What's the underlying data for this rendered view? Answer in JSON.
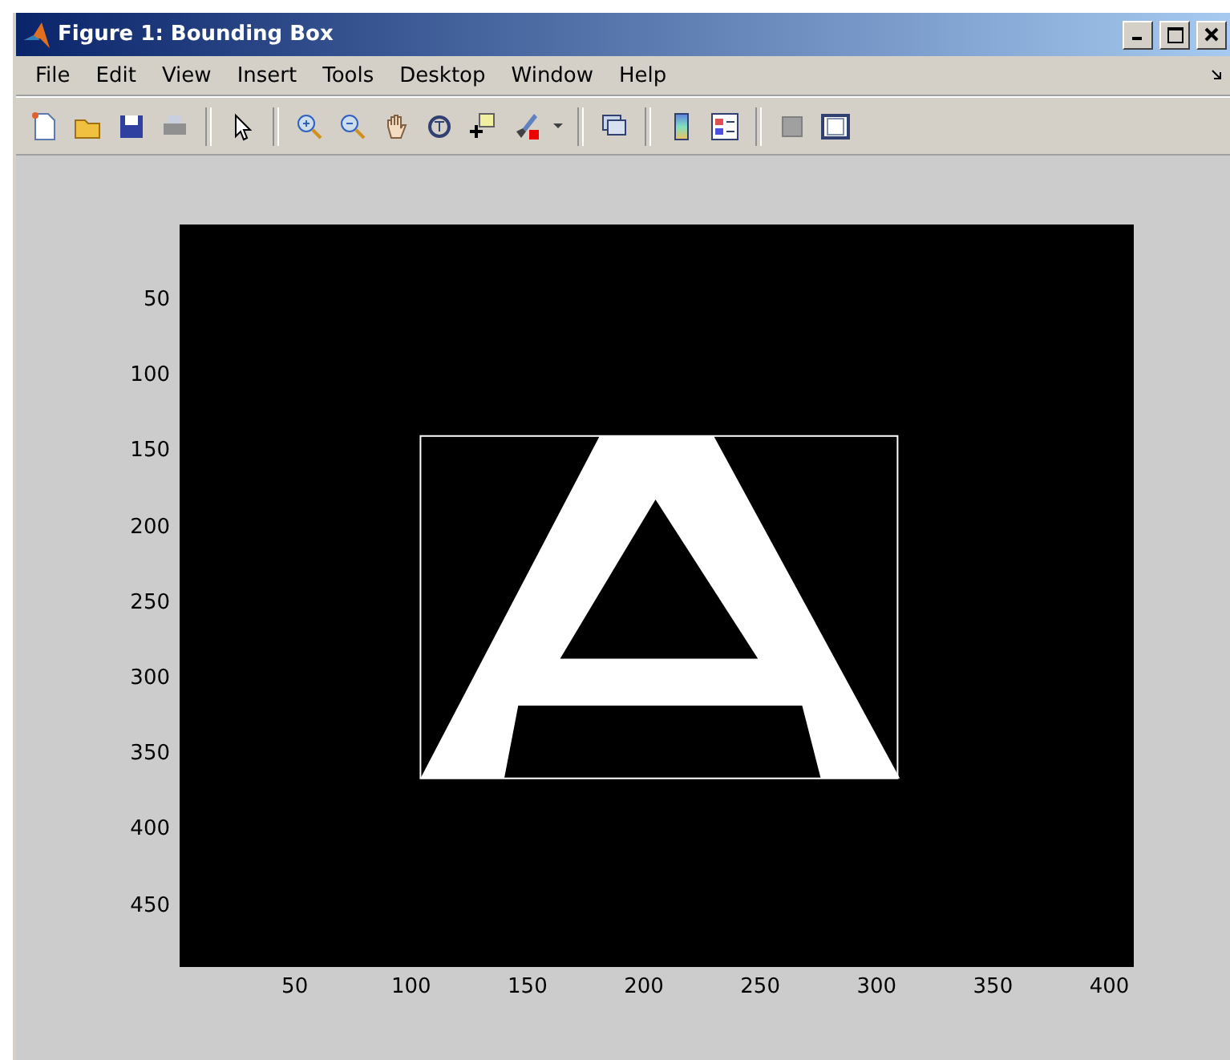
{
  "window": {
    "title": "Figure 1: Bounding Box"
  },
  "menu": [
    "File",
    "Edit",
    "View",
    "Insert",
    "Tools",
    "Desktop",
    "Window",
    "Help"
  ],
  "axes": {
    "y_ticks": [
      "50",
      "100",
      "150",
      "200",
      "250",
      "300",
      "350",
      "400",
      "450"
    ],
    "x_ticks": [
      "50",
      "100",
      "150",
      "200",
      "250",
      "300",
      "350",
      "400"
    ]
  }
}
